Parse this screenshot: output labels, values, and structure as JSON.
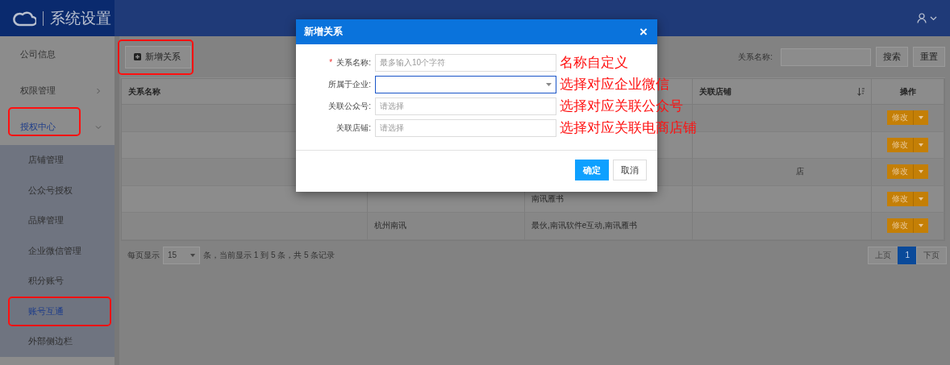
{
  "header": {
    "title": "系统设置"
  },
  "sidebar": {
    "items": [
      {
        "label": "公司信息",
        "kind": "link",
        "selected": false,
        "marked": false
      },
      {
        "label": "权限管理",
        "kind": "group",
        "expanded": false,
        "selected": false,
        "marked": false
      },
      {
        "label": "授权中心",
        "kind": "group",
        "expanded": true,
        "selected": true,
        "marked": true,
        "children": [
          {
            "label": "店铺管理",
            "selected": false,
            "marked": false
          },
          {
            "label": "公众号授权",
            "selected": false,
            "marked": false
          },
          {
            "label": "品牌管理",
            "selected": false,
            "marked": false
          },
          {
            "label": "企业微信管理",
            "selected": false,
            "marked": false
          },
          {
            "label": "积分账号",
            "selected": false,
            "marked": false
          },
          {
            "label": "账号互通",
            "selected": true,
            "marked": true
          },
          {
            "label": "外部侧边栏",
            "selected": false,
            "marked": false
          }
        ]
      }
    ]
  },
  "toolbar": {
    "add_button": {
      "label": "新增关系",
      "marked": true
    },
    "search_label": "关系名称:",
    "search_button": "搜索",
    "reset_button": "重置"
  },
  "table": {
    "columns": [
      {
        "label": "关系名称"
      },
      {},
      {},
      {
        "label": "关联店铺",
        "sortable": true
      },
      {
        "label": "操作"
      }
    ],
    "rows": [
      {
        "action": "修改"
      },
      {
        "action": "修改"
      },
      {
        "store": "店",
        "action": "修改"
      },
      {
        "column_3": "南讯雁书",
        "action": "修改"
      },
      {
        "column_2": "杭州南讯",
        "column_3": "最伙,南讯软件e互动,南讯雁书",
        "action": "修改"
      }
    ]
  },
  "pagination": {
    "page_size_label": "每页显示",
    "page_size": "15",
    "summary": "条，当前显示 1 到 5 条，共 5 条记录",
    "pages": [
      {
        "label": "上页",
        "selected": false
      },
      {
        "label": "1",
        "selected": true
      },
      {
        "label": "下页",
        "selected": false
      }
    ]
  },
  "dialog": {
    "title": "新增关系",
    "close": "×",
    "fields": [
      {
        "label": "关系名称:",
        "required_mark": "*",
        "kind": "text",
        "placeholder": "最多输入10个字符",
        "focused": false,
        "note": "名称自定义"
      },
      {
        "label": "所属于企业:",
        "kind": "select",
        "focused": true,
        "note": "选择对应企业微信"
      },
      {
        "label": "关联公众号:",
        "kind": "text",
        "placeholder": "请选择",
        "focused": false,
        "note": "选择对应关联公众号"
      },
      {
        "label": "关联店铺:",
        "kind": "text",
        "placeholder": "请选择",
        "focused": false,
        "note": "选择对应关联电商店铺"
      }
    ],
    "buttons": [
      {
        "label": "确定",
        "kind": "primary"
      },
      {
        "label": "取消",
        "kind": "default"
      }
    ]
  }
}
